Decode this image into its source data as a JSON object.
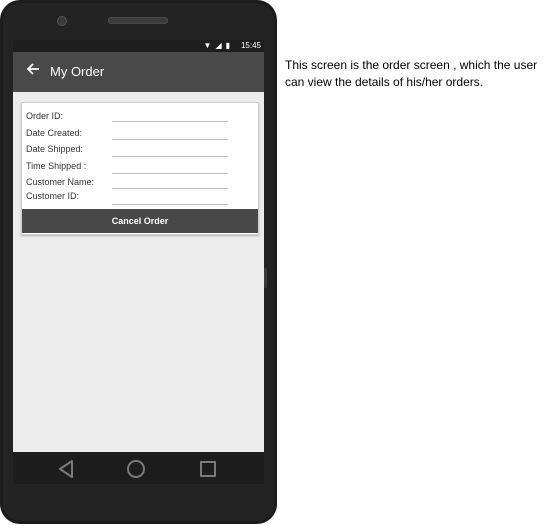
{
  "status_bar": {
    "time": "15:45",
    "icons": [
      "wifi-icon",
      "signal-icon",
      "battery-icon"
    ]
  },
  "app_bar": {
    "title": "My Order",
    "back_icon": "arrow-left-icon"
  },
  "order_card": {
    "fields": [
      {
        "label": "Order ID:",
        "value": ""
      },
      {
        "label": "Date Created:",
        "value": ""
      },
      {
        "label": "Date Shipped:",
        "value": ""
      },
      {
        "label": "Time Shipped :",
        "value": ""
      },
      {
        "label": "Customer Name:",
        "value": ""
      },
      {
        "label": "Customer ID:",
        "value": ""
      }
    ],
    "cancel_label": "Cancel Order"
  },
  "nav_bar": {
    "icons": [
      "back-triangle-icon",
      "home-circle-icon",
      "recent-square-icon"
    ]
  },
  "caption": "This screen is the order screen , which the user can view the details of his/her orders.",
  "colors": {
    "app_bar": "#494949",
    "button": "#484848",
    "screen_bg": "#ececec"
  }
}
